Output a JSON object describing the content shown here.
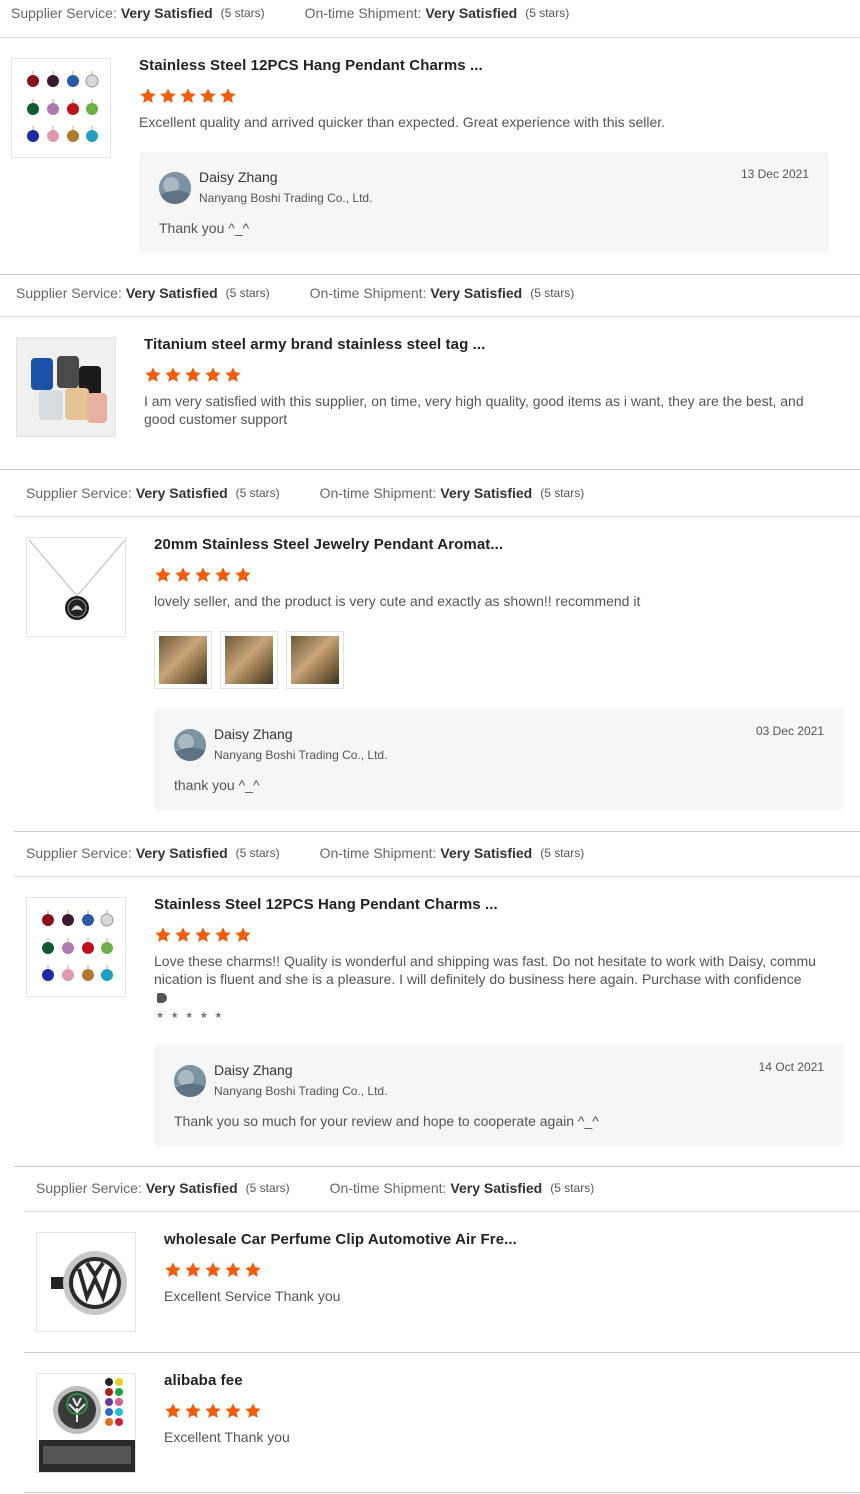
{
  "labels": {
    "supplier_service": "Supplier Service:",
    "ontime_shipment": "On-time Shipment:",
    "very_satisfied": "Very Satisfied",
    "five_stars": "(5 stars)"
  },
  "colors": {
    "star": "#f25c0b",
    "reply_bg": "#f5f6f7"
  },
  "reviews": [
    {
      "title": "Stainless Steel 12PCS Hang Pendant Charms ...",
      "rating": 5,
      "text": "Excellent quality and arrived quicker than expected. Great experience with this seller.",
      "reply": {
        "name": "Daisy Zhang",
        "company": "Nanyang Boshi Trading Co., Ltd.",
        "date": "13 Dec 2021",
        "message": "Thank you ^_^"
      }
    },
    {
      "title": "Titanium steel army brand stainless steel tag ...",
      "rating": 5,
      "text_line1": "I am very satisfied with this supplier, on time, very high quality, good items as i want, they are the best, and",
      "text_line2": "good customer support"
    },
    {
      "title": "20mm Stainless Steel Jewelry Pendant Aromat...",
      "rating": 5,
      "text": "lovely seller, and the product is very cute and exactly as shown!! recommend it",
      "photos": 3,
      "reply": {
        "name": "Daisy Zhang",
        "company": "Nanyang Boshi Trading Co., Ltd.",
        "date": "03 Dec 2021",
        "message": "thank you ^_^"
      }
    },
    {
      "title": "Stainless Steel 12PCS Hang Pendant Charms ...",
      "rating": 5,
      "text_line1": "Love these charms!! Quality is wonderful and shipping was fast. Do not hesitate to work with Daisy, commu",
      "text_line2": "nication is fluent and she is a pleasure. I will definitely do business here again. Purchase with confidence",
      "small_stars": "★ ★ ★ ★ ★",
      "reply": {
        "name": "Daisy Zhang",
        "company": "Nanyang Boshi Trading Co., Ltd.",
        "date": "14 Oct 2021",
        "message": "Thank you so much for your review and hope to cooperate again ^_^"
      }
    },
    {
      "title": "wholesale Car Perfume Clip Automotive Air Fre...",
      "rating": 5,
      "text": "Excellent Service Thank you"
    },
    {
      "title": "alibaba fee",
      "rating": 5,
      "text": "Excellent Thank you"
    }
  ]
}
